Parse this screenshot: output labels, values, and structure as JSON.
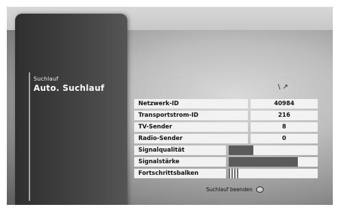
{
  "menu": {
    "breadcrumb": "Suchlauf",
    "title": "Auto. Suchlauf"
  },
  "status_rows": [
    {
      "label": "Netzwerk-ID",
      "value": "40984"
    },
    {
      "label": "Transportstrom-ID",
      "value": "216"
    },
    {
      "label": "TV-Sender",
      "value": "8"
    },
    {
      "label": "Radio-Sender",
      "value": "0"
    }
  ],
  "signal_rows": [
    {
      "label": "Signalqualität",
      "level": 0.28
    },
    {
      "label": "Signalstärke",
      "level": 0.78
    }
  ],
  "progress": {
    "label": "Fortschrittsbalken",
    "level": 0.12
  },
  "footer": {
    "action_label": "Suchlauf beenden",
    "action_icon": "ok-button-icon"
  }
}
